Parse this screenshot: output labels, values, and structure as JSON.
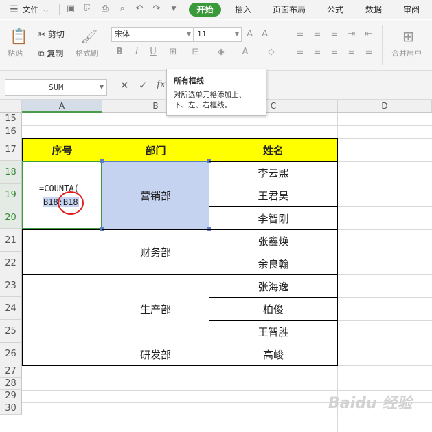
{
  "menubar": {
    "file_label": "文件",
    "tabs": [
      "开始",
      "插入",
      "页面布局",
      "公式",
      "数据",
      "审阅"
    ]
  },
  "ribbon": {
    "paste": "粘贴",
    "cut": "剪切",
    "copy": "复制",
    "format_painter": "格式刷",
    "font_name": "宋体",
    "font_size": "11",
    "merge_center": "合并居中"
  },
  "formula_bar": {
    "name_box": "SUM",
    "fx": "fx"
  },
  "tooltip": {
    "title": "所有框线",
    "body": "对所选单元格添加上、下、左、右框线。"
  },
  "columns": [
    "A",
    "B",
    "C",
    "D"
  ],
  "rows": [
    "15",
    "16",
    "17",
    "18",
    "19",
    "20",
    "21",
    "22",
    "23",
    "24",
    "25",
    "26",
    "27",
    "28",
    "29",
    "30"
  ],
  "table": {
    "headers": [
      "序号",
      "部门",
      "姓名"
    ],
    "formula_line1": "=COUNTA(",
    "formula_ref1": "B18",
    "formula_colon": ":",
    "formula_ref2": "B18",
    "departments": [
      "营销部",
      "财务部",
      "生产部",
      "研发部"
    ],
    "names": [
      "李云熙",
      "王君昊",
      "李智刚",
      "张鑫焕",
      "余良翰",
      "张海逸",
      "柏俊",
      "王智胜",
      "高峻"
    ]
  },
  "watermark": "Baidu 经验",
  "colors": {
    "header_fill": "#ffff00",
    "selection_fill": "#c5d3f1",
    "active_tab": "#3a9a3a",
    "highlight_circle": "#e02020"
  }
}
